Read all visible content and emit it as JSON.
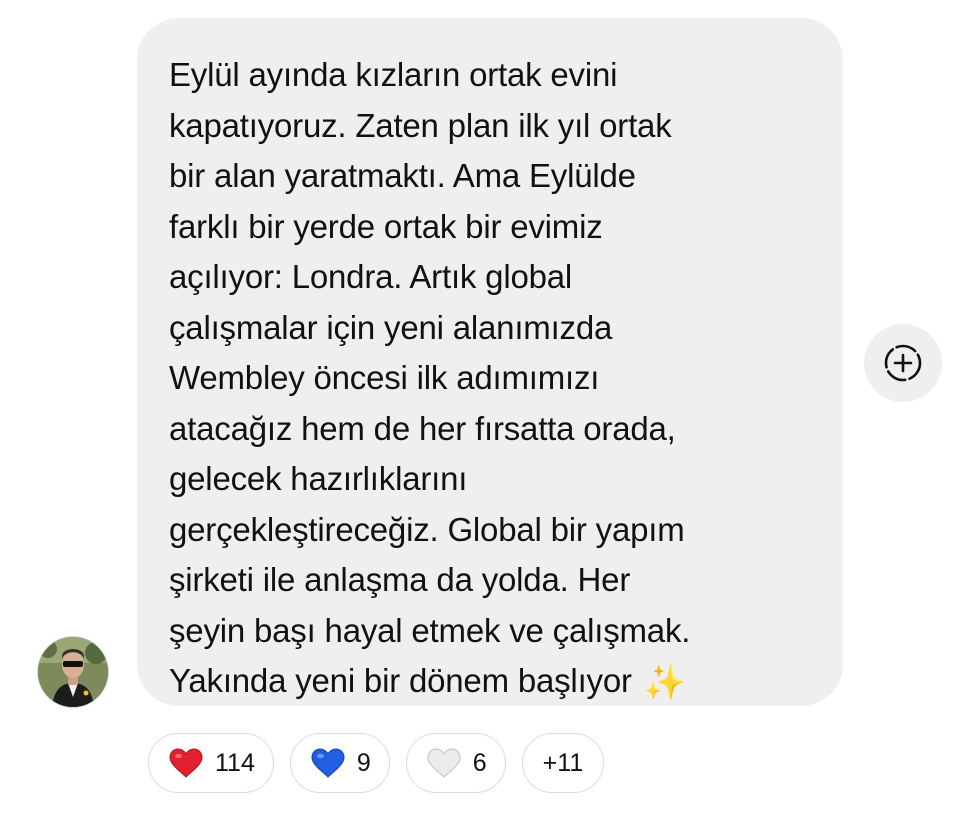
{
  "message": {
    "text": "Eylül ayında kızların ortak evini\nkapatıyoruz. Zaten plan ilk yıl ortak\nbir alan yaratmaktı. Ama Eylülde\nfarklı bir yerde ortak bir evimiz\naçılıyor: Londra. Artık global\nçalışmalar için yeni alanımızda\nWembley öncesi ilk adımımızı\natacağız hem de her fırsatta orada,\ngelecek hazırlıklarını\ngerçekleştireceğiz. Global bir yapım\nşirketi ile anlaşma da yolda. Her\nşeyin başı hayal etmek ve çalışmak.\nYakında yeni bir dönem başlıyor",
    "emoji": "✨",
    "emoji_icon": "sparkles-icon"
  },
  "reactions": [
    {
      "icon": "red-heart-icon",
      "color": "#e0202e",
      "count": "114"
    },
    {
      "icon": "blue-heart-icon",
      "color": "#1f5fe0",
      "count": "9"
    },
    {
      "icon": "white-heart-icon",
      "color": "#e6e6e6",
      "count": "6"
    }
  ],
  "more_reactions": "+11",
  "add_reaction_icon": "add-reaction-icon",
  "colors": {
    "bubble": "#efefef",
    "text": "#111111",
    "pill_border": "#dcdcdc"
  }
}
